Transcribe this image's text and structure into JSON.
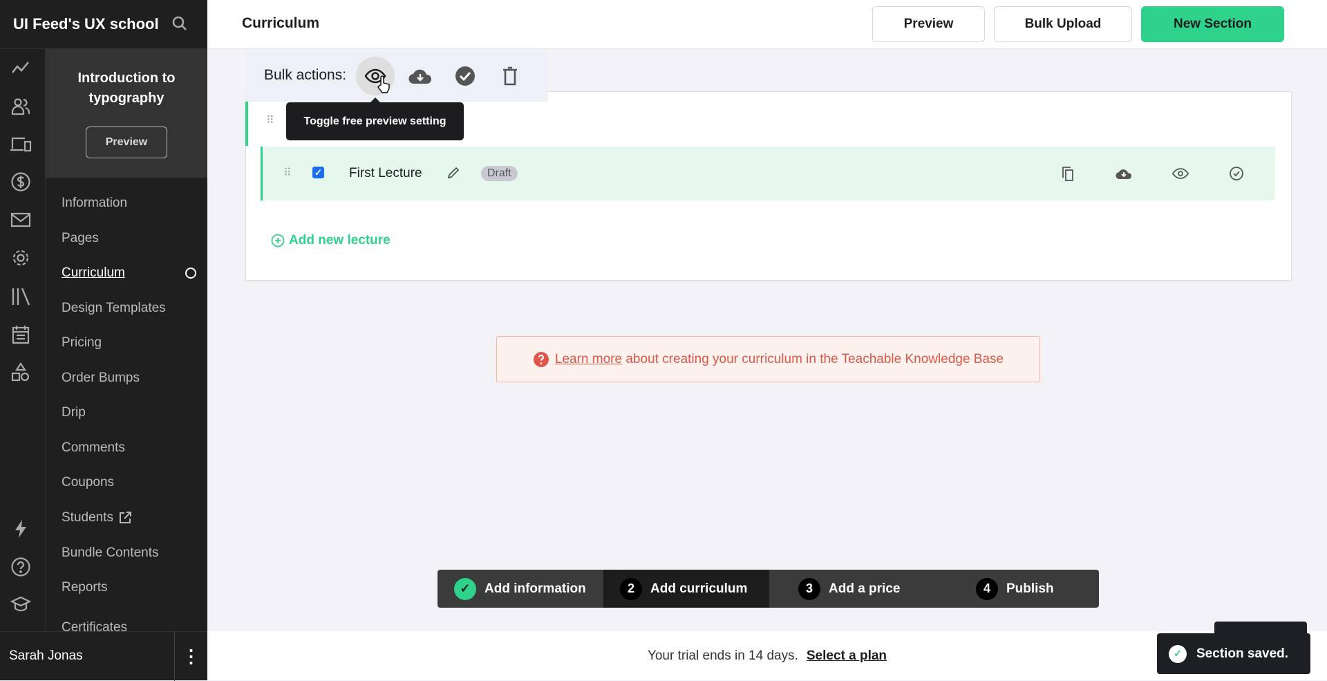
{
  "app": {
    "school_name": "UI Feed's UX school"
  },
  "course": {
    "title": "Introduction to typography",
    "preview_label": "Preview"
  },
  "nav": {
    "items": [
      {
        "label": "Information"
      },
      {
        "label": "Pages"
      },
      {
        "label": "Curriculum",
        "active": true
      },
      {
        "label": "Design Templates"
      },
      {
        "label": "Pricing"
      },
      {
        "label": "Order Bumps"
      },
      {
        "label": "Drip"
      },
      {
        "label": "Comments"
      },
      {
        "label": "Coupons"
      },
      {
        "label": "Students",
        "external": true
      },
      {
        "label": "Bundle Contents"
      },
      {
        "label": "Reports"
      },
      {
        "label": "Certificates"
      }
    ]
  },
  "rail": {
    "icons": [
      "trend-line-icon",
      "users-icon",
      "devices-icon",
      "dollar-icon",
      "mail-icon",
      "gear-icon",
      "library-icon",
      "calendar-icon",
      "shapes-icon",
      "lightning-icon",
      "help-icon",
      "graduation-cap-icon"
    ]
  },
  "user": {
    "name": "Sarah Jonas"
  },
  "header": {
    "title": "Curriculum",
    "preview_label": "Preview",
    "bulk_upload_label": "Bulk Upload",
    "new_section_label": "New Section"
  },
  "bulk": {
    "label": "Bulk actions:",
    "tooltip": "Toggle free preview setting"
  },
  "lecture": {
    "title": "First Lecture",
    "status": "Draft",
    "checked": true
  },
  "add_lecture_label": "Add new lecture",
  "info": {
    "link": "Learn more",
    "text": "about creating your curriculum in the Teachable Knowledge Base"
  },
  "stepper": {
    "steps": [
      {
        "num": "✓",
        "label": "Add information",
        "state": "done"
      },
      {
        "num": "2",
        "label": "Add curriculum",
        "state": "current"
      },
      {
        "num": "3",
        "label": "Add a price",
        "state": "todo"
      },
      {
        "num": "4",
        "label": "Publish",
        "state": "todo"
      }
    ]
  },
  "footer": {
    "trial_text": "Your trial ends in 14 days.",
    "plan_link": "Select a plan"
  },
  "toast": {
    "message": "Section saved."
  },
  "colors": {
    "accent": "#2ed28b",
    "sidebar": "#1f1f1f",
    "info": "#d8594a",
    "checkbox": "#1a6ff0"
  }
}
